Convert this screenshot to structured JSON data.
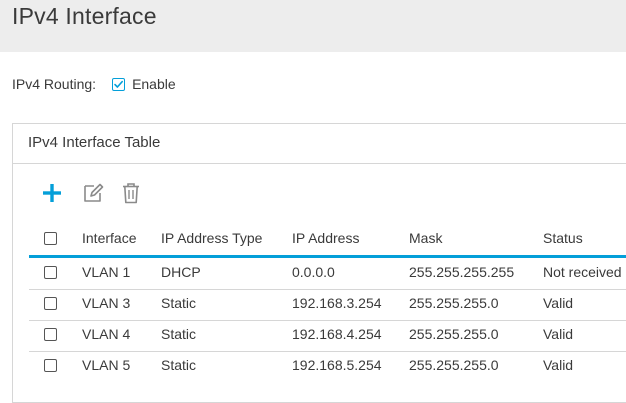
{
  "page": {
    "title": "IPv4 Interface"
  },
  "routing": {
    "label": "IPv4 Routing:",
    "enable_label": "Enable",
    "enabled": true
  },
  "panel": {
    "title": "IPv4 Interface Table"
  },
  "toolbar": {
    "add_icon": "plus-icon",
    "edit_icon": "edit-icon",
    "delete_icon": "trash-icon"
  },
  "table": {
    "columns": {
      "interface": "Interface",
      "type": "IP Address Type",
      "ip": "IP Address",
      "mask": "Mask",
      "status": "Status"
    },
    "rows": [
      {
        "interface": "VLAN 1",
        "type": "DHCP",
        "ip": "0.0.0.0",
        "mask": "255.255.255.255",
        "status": "Not received"
      },
      {
        "interface": "VLAN 3",
        "type": "Static",
        "ip": "192.168.3.254",
        "mask": "255.255.255.0",
        "status": "Valid"
      },
      {
        "interface": "VLAN 4",
        "type": "Static",
        "ip": "192.168.4.254",
        "mask": "255.255.255.0",
        "status": "Valid"
      },
      {
        "interface": "VLAN 5",
        "type": "Static",
        "ip": "192.168.5.254",
        "mask": "255.255.255.0",
        "status": "Valid"
      }
    ]
  },
  "colors": {
    "accent": "#049fd9",
    "header_bg": "#ededed",
    "border": "#d6d6d6"
  }
}
